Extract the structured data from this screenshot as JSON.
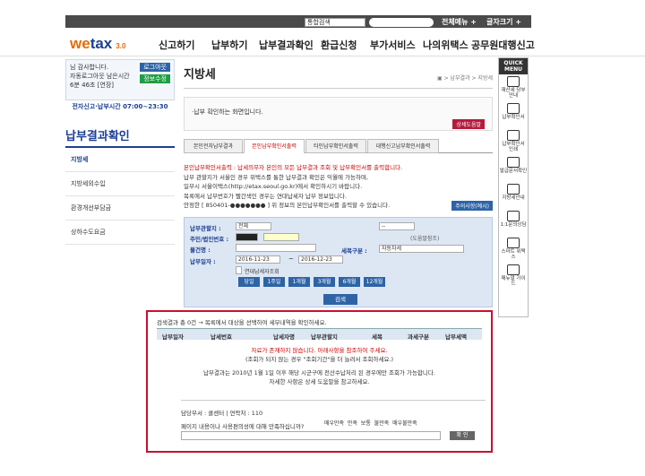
{
  "topbar": {
    "select_value": "통합검색",
    "all_menu": "전체메뉴 +",
    "font_size": "글자크기 +"
  },
  "logo": {
    "main": "we",
    "tax": "tax",
    "sub": "위택스",
    "badge": "3.0"
  },
  "nav": [
    "신고하기",
    "납부하기",
    "납부결과확인",
    "환급신청",
    "부가서비스",
    "나의위택스",
    "공무원대행신고"
  ],
  "login": {
    "greeting": "님 감사합니다.",
    "auto_logout": "자동로그아웃 남은시간",
    "time": "6분 46초 [연장]",
    "logout_btn": "로그아웃",
    "info_btn": "정보수정",
    "hours": "전자신고·납부시간 07:00~23:30"
  },
  "sidebar": {
    "title": "납부결과확인",
    "items": [
      "지방세",
      "지방세외수입",
      "환경개선부담금",
      "상하수도요금"
    ]
  },
  "main": {
    "title": "지방세",
    "breadcrumb": "▣ > 납부결과 > 지방세",
    "info_text": "·납부 확인하는 화면입니다.",
    "help_btn": "상세도움말",
    "tabs": [
      "본인전자납부결과",
      "본인납부확인서출력",
      "타인납부확인서출력",
      "대행신고납부확인서출력"
    ],
    "notes": [
      "본인납부확인서출력 : 납세의무자 본인의 모든 납부결과 조회 및 납부확인서를 출력합니다.",
      "납부 관할지가 서울인 경우 위택스를 통한 납부결과 확인은 익월에 가능하며,",
      "일부시 서울이택스(http://etax.seoul.go.kr)에서 확인하시기 바랍니다.",
      "목록에서 납부번호가 빨간색인 경우는 연대납세자 납부 정보입니다.",
      "안정한 [ 850401-●●●●●●● ] 위 정보의 본인납부확인서를 출력할 수 있습니다."
    ],
    "example_btn": "주의사항(예시)",
    "form": {
      "label_region": "납부관할지 :",
      "region_value": "전체",
      "label_id": "주민/법인번호 :",
      "label_item": "물건명 :",
      "label_tax": "세목구분 :",
      "tax_value": "자동차세",
      "label_date": "납부일자 :",
      "date_from": "2016-11-23",
      "date_to": "2016-12-23",
      "joint": "연대납세자조회",
      "dropdown_value": "--",
      "hint": "(도움말참조)",
      "quick": [
        "당일",
        "1주일",
        "1개월",
        "3개월",
        "6개월",
        "12개월"
      ],
      "search_btn": "검색"
    }
  },
  "result": {
    "title": "검색결과 총 0건 → 목록에서 대상을 선택하여 세부내역을 확인하세요.",
    "headers": [
      "납부일자",
      "납세번호",
      "납세자명",
      "납부관할지",
      "세목",
      "과세구분",
      "납부세액"
    ],
    "empty1": "자료가 존재하지 않습니다. 아래사항을 참조하여 주세요.",
    "empty2": "(조회가 되지 않는 경우 \"조회기간\"을 더 늘려서 조회하세요.)",
    "notice1": "납부결과는 2010년 1월 1일 이후 해당 시군구에 전산수납처리 된 경우에만 조회가 가능합니다.",
    "notice2": "자세한 사항은 상세 도움말을 참고하세요.",
    "dept": "담당부서 : 콜센터  |  연락처 : 110",
    "survey_q": "페이지 내용이나 사용편의성에 대해 만족하십니까?",
    "survey_opts": [
      "매우만족",
      "만족",
      "보통",
      "불만족",
      "매우불만족"
    ],
    "confirm": "확 인"
  },
  "quick_menu": {
    "title": "QUICK MENU",
    "items": [
      "재산세 당부안내",
      "납부확인서",
      "납부확인서 인쇄",
      "발급문서확인",
      "지방세안내",
      "1:1문의상담",
      "스마트 위택스",
      "매뉴얼 가이드"
    ]
  }
}
